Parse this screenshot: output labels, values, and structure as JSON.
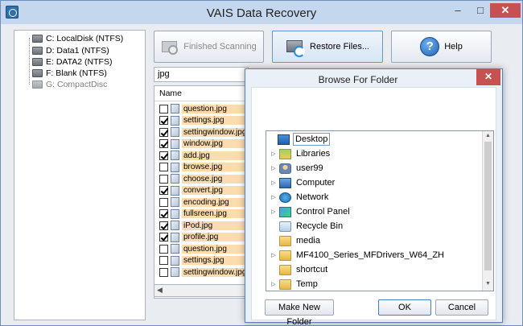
{
  "window": {
    "title": "VAIS Data Recovery",
    "min_glyph": "–",
    "max_glyph": "□",
    "close_glyph": "✕"
  },
  "drives": [
    {
      "label": "C: LocalDisk (NTFS)",
      "dimmed": false
    },
    {
      "label": "D: Data1 (NTFS)",
      "dimmed": false
    },
    {
      "label": "E: DATA2 (NTFS)",
      "dimmed": false
    },
    {
      "label": "F: Blank (NTFS)",
      "dimmed": false
    },
    {
      "label": "G: CompactDisc",
      "dimmed": true
    }
  ],
  "toolbar": {
    "finished_label": "Finished Scanning",
    "restore_label": "Restore Files...",
    "help_label": "Help",
    "help_glyph": "?"
  },
  "files": {
    "filter_value": "jpg",
    "column_name": "Name",
    "rows": [
      {
        "name": "question.jpg",
        "checked": false
      },
      {
        "name": "settings.jpg",
        "checked": true
      },
      {
        "name": "settingwindow.jpg",
        "checked": true
      },
      {
        "name": "window.jpg",
        "checked": true
      },
      {
        "name": "add.jpg",
        "checked": true
      },
      {
        "name": "browse.jpg",
        "checked": false
      },
      {
        "name": "choose.jpg",
        "checked": false
      },
      {
        "name": "convert.jpg",
        "checked": true
      },
      {
        "name": "encoding.jpg",
        "checked": false
      },
      {
        "name": "fullsreen.jpg",
        "checked": true
      },
      {
        "name": "iPod.jpg",
        "checked": true
      },
      {
        "name": "profile.jpg",
        "checked": true
      },
      {
        "name": "question.jpg",
        "checked": false
      },
      {
        "name": "settings.jpg",
        "checked": false
      },
      {
        "name": "settingwindow.jpg",
        "checked": false
      }
    ]
  },
  "dialog": {
    "title": "Browse For Folder",
    "close_glyph": "✕",
    "tree": [
      {
        "label": "Desktop",
        "icon": "desktop-icon",
        "expander": "",
        "selected": true
      },
      {
        "label": "Libraries",
        "icon": "libraries-icon",
        "expander": "▷",
        "selected": false
      },
      {
        "label": "user99",
        "icon": "user-icon",
        "expander": "▷",
        "selected": false
      },
      {
        "label": "Computer",
        "icon": "computer-icon",
        "expander": "▷",
        "selected": false
      },
      {
        "label": "Network",
        "icon": "network-icon",
        "expander": "▷",
        "selected": false
      },
      {
        "label": "Control Panel",
        "icon": "control-panel-icon",
        "expander": "▷",
        "selected": false
      },
      {
        "label": "Recycle Bin",
        "icon": "recycle-bin-icon",
        "expander": "",
        "selected": false
      },
      {
        "label": "media",
        "icon": "folder-icon",
        "expander": "",
        "selected": false
      },
      {
        "label": "MF4100_Series_MFDrivers_W64_ZH",
        "icon": "folder-icon",
        "expander": "▷",
        "selected": false
      },
      {
        "label": "shortcut",
        "icon": "folder-icon",
        "expander": "",
        "selected": false
      },
      {
        "label": "Temp",
        "icon": "folder-icon",
        "expander": "▷",
        "selected": false
      }
    ],
    "new_folder_label": "Make New Folder",
    "ok_label": "OK",
    "cancel_label": "Cancel"
  }
}
